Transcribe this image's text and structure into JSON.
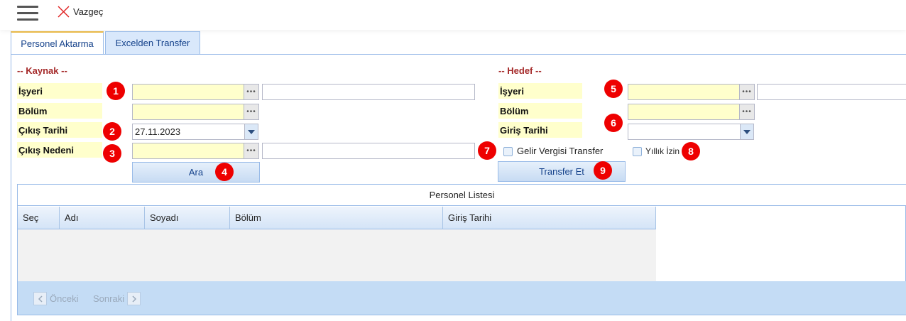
{
  "toolbar": {
    "cancel_label": "Vazgeç"
  },
  "tabs": [
    {
      "label": "Personel Aktarma"
    },
    {
      "label": "Excelden Transfer"
    }
  ],
  "source": {
    "title": "-- Kaynak --",
    "workplace_label": "İşyeri",
    "department_label": "Bölüm",
    "exit_date_label": "Çıkış Tarihi",
    "exit_date_value": "27.11.2023",
    "exit_reason_label": "Çıkış Nedeni",
    "search_button": "Ara"
  },
  "target": {
    "title": "-- Hedef --",
    "workplace_label": "İşyeri",
    "department_label": "Bölüm",
    "entry_date_label": "Giriş Tarihi",
    "income_tax_label": "Gelir Vergisi Transfer",
    "annual_leave_label": "Yıllık İzin",
    "transfer_button": "Transfer Et"
  },
  "badges": [
    "1",
    "2",
    "3",
    "4",
    "5",
    "6",
    "7",
    "8",
    "9"
  ],
  "grid": {
    "title": "Personel Listesi",
    "columns": [
      "Seç",
      "Adı",
      "Soyadı",
      "Bölüm",
      "Giriş Tarihi"
    ],
    "rows": []
  },
  "pager": {
    "prev_label": "Önceki",
    "next_label": "Sonraki"
  },
  "colors": {
    "accent": "#15428b",
    "badge": "#ee0000",
    "section": "#a52a2a",
    "label_bg": "#ffffcc"
  }
}
